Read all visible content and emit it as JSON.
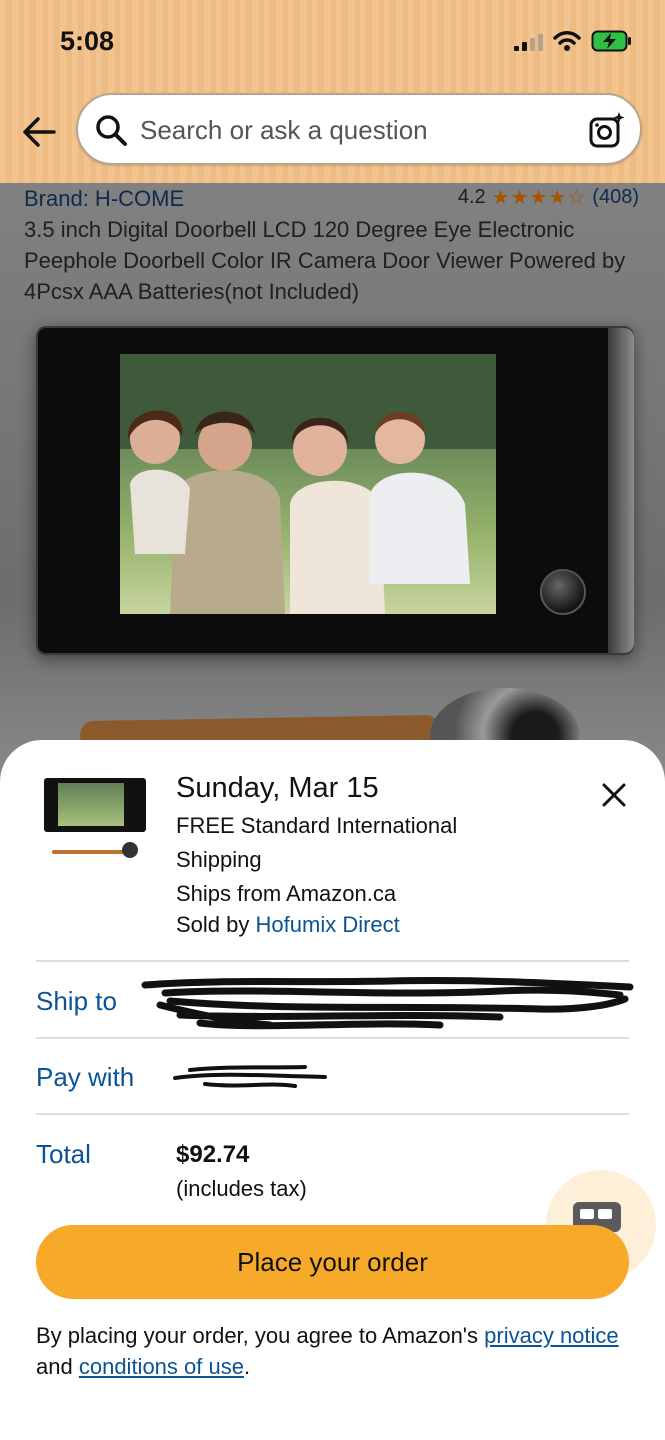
{
  "status_bar": {
    "time": "5:08"
  },
  "search": {
    "placeholder": "Search or ask a question"
  },
  "product": {
    "brand": "Brand: H-COME",
    "rating": "4.2",
    "stars": "★★★★☆",
    "rating_count": "(408)",
    "title": "3.5 inch Digital Doorbell LCD 120 Degree Eye Electronic Peephole Doorbell Color IR Camera Door Viewer Powered by 4Pcsx AAA Batteries(not Included)"
  },
  "order_sheet": {
    "delivery_date": "Sunday, Mar 15",
    "shipping_line1": "FREE Standard International",
    "shipping_line2": "Shipping",
    "ships_from": "Ships from Amazon.ca",
    "sold_by_prefix": "Sold by",
    "seller": "Hofumix Direct",
    "ship_to_label": "Ship to",
    "pay_with_label": "Pay with",
    "total_label": "Total",
    "total_amount": "$92.74",
    "total_note": "(includes tax)",
    "place_order_label": "Place your order",
    "legal_prefix": "By placing your order, you agree to Amazon's",
    "privacy_link": "privacy notice",
    "legal_middle": "and",
    "conditions_link": "conditions of use",
    "legal_suffix": "."
  },
  "colors": {
    "header_bg": "#f2c590",
    "link_blue": "#0b5394",
    "button_orange": "#f7a92a",
    "star_orange": "#a65400"
  }
}
